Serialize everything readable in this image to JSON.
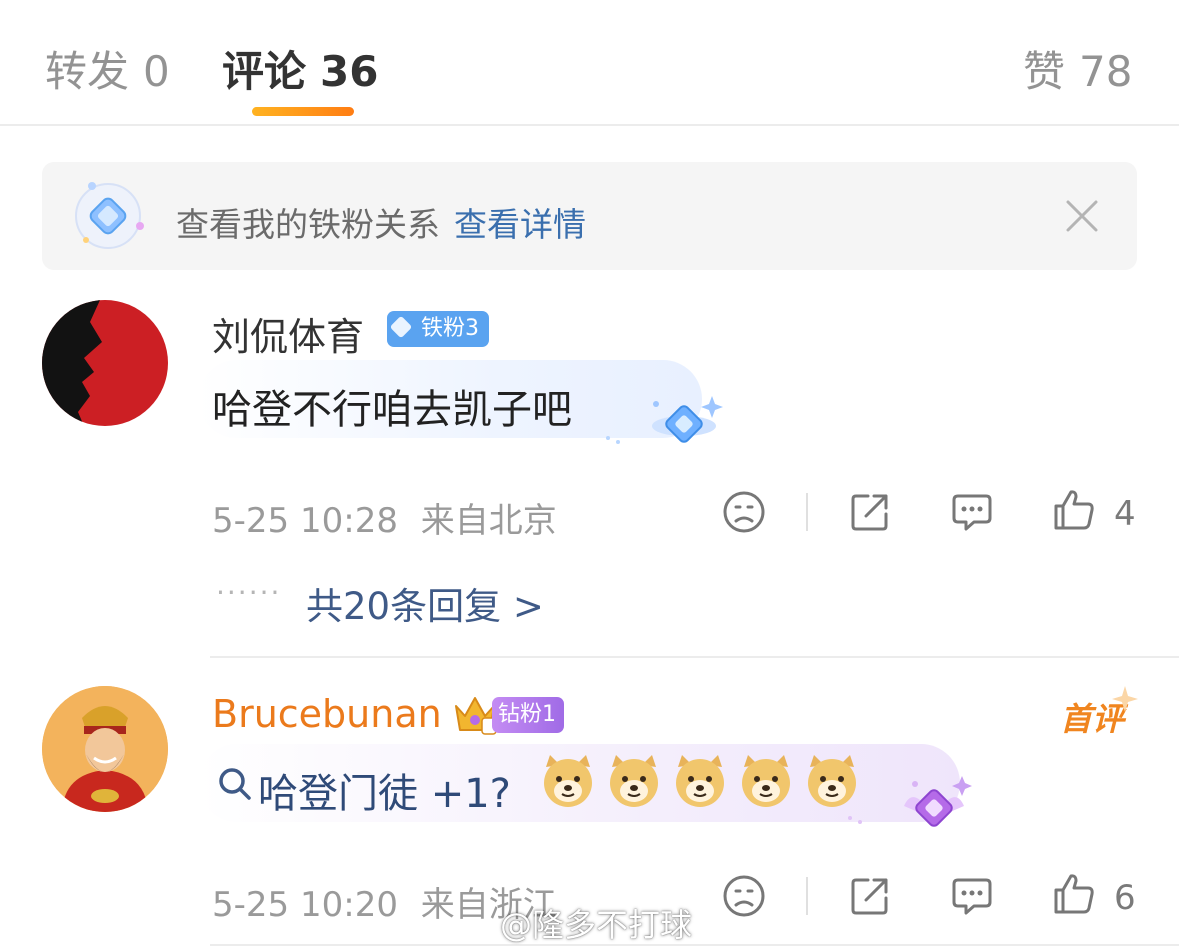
{
  "tabs": [
    {
      "label": "转发",
      "count": "0"
    },
    {
      "label": "评论",
      "count": "36"
    },
    {
      "label": "赞",
      "count": "78"
    }
  ],
  "banner": {
    "text": "查看我的铁粉关系",
    "link": "查看详情"
  },
  "comments": [
    {
      "username": "刘侃体育",
      "badge": "铁粉3",
      "text": "哈登不行咱去凯子吧",
      "time": "5-25 10:28",
      "location": "来自北京",
      "likes": "4",
      "replies_label": "共20条回复 >"
    },
    {
      "username": "Brucebunan",
      "badge": "钻粉1",
      "first_tag": "首评",
      "text": "哈登门徒 +1?",
      "time": "5-25 10:20",
      "location": "来自浙江",
      "likes": "6"
    }
  ],
  "watermark": "@隆多不打球",
  "colors": {
    "accent_orange": "#ff8a1a",
    "link_blue": "#3a6fae",
    "username_orange": "#eb7a1c",
    "iron_badge": "#5aa3f0",
    "diamond_badge": "#a56be8"
  }
}
